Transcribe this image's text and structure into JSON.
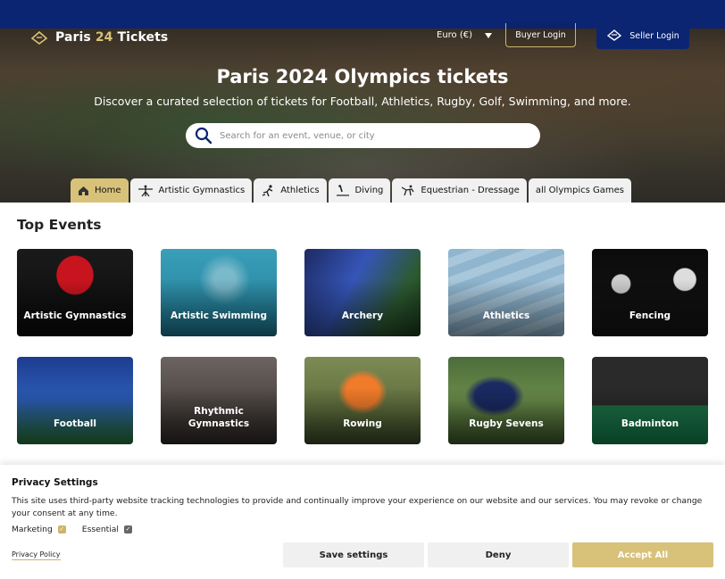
{
  "header": {
    "brand_prefix": "Paris ",
    "brand_number": "24",
    "brand_suffix": " Tickets",
    "currency": "Euro (€)",
    "buyer_login": "Buyer Login",
    "seller_login": "Seller Login"
  },
  "hero": {
    "title": "Paris 2024 Olympics tickets",
    "subtitle": "Discover a curated selection of tickets for Football, Athletics, Rugby, Golf, Swimming, and more.",
    "search_placeholder": "Search for an event, venue, or city"
  },
  "tabs": [
    {
      "label": "Home",
      "icon": "home-icon",
      "active": true
    },
    {
      "label": "Artistic Gymnastics",
      "icon": "gymnastics-icon",
      "active": false
    },
    {
      "label": "Athletics",
      "icon": "runner-icon",
      "active": false
    },
    {
      "label": "Diving",
      "icon": "diving-icon",
      "active": false
    },
    {
      "label": "Equestrian - Dressage",
      "icon": "horse-icon",
      "active": false
    },
    {
      "label": "all Olympics Games",
      "icon": "",
      "active": false
    }
  ],
  "top_events": {
    "title": "Top Events",
    "cards": [
      {
        "label": "Artistic Gymnastics"
      },
      {
        "label": "Artistic Swimming"
      },
      {
        "label": "Archery"
      },
      {
        "label": "Athletics"
      },
      {
        "label": "Fencing"
      },
      {
        "label": "Football"
      },
      {
        "label": "Rhythmic Gymnastics"
      },
      {
        "label": "Rowing"
      },
      {
        "label": "Rugby Sevens"
      },
      {
        "label": "Badminton"
      }
    ]
  },
  "privacy": {
    "title": "Privacy Settings",
    "text": "This site uses third-party website tracking technologies to provide and continually improve your experience on our website and our services. You may revoke or change your consent at any time.",
    "marketing_label": "Marketing",
    "essential_label": "Essential",
    "policy_link": "Privacy Policy",
    "save_label": "Save settings",
    "deny_label": "Deny",
    "accept_label": "Accept All"
  },
  "colors": {
    "navy": "#0b2572",
    "gold": "#d8c27a"
  }
}
